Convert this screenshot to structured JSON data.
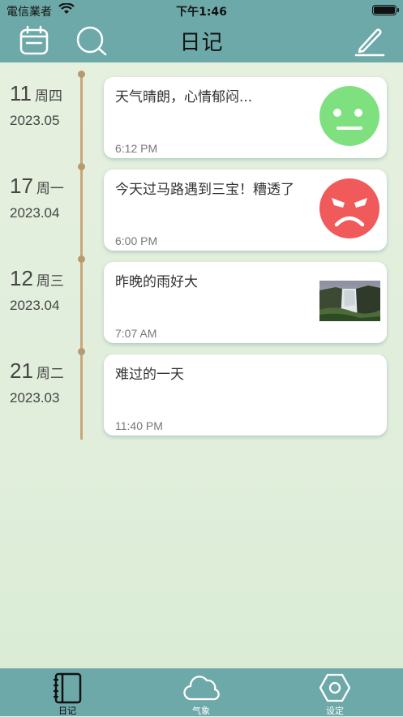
{
  "status_bar": {
    "carrier": "電信業者",
    "time": "下午1:46"
  },
  "nav": {
    "title": "日记",
    "left_icons": [
      "calendar-icon",
      "search-icon"
    ],
    "right_icon": "edit-icon"
  },
  "entries": [
    {
      "day": "11",
      "weekday": "周四",
      "year_month": "2023.05",
      "title": "天气晴朗，心情郁闷...",
      "time": "6:12 PM",
      "media": "neutral-face-icon",
      "media_color": "#7fe07f"
    },
    {
      "day": "17",
      "weekday": "周一",
      "year_month": "2023.04",
      "title": "今天过马路遇到三宝！糟透了",
      "time": "6:00 PM",
      "media": "angry-face-icon",
      "media_color": "#f05a5a"
    },
    {
      "day": "12",
      "weekday": "周三",
      "year_month": "2023.04",
      "title": "昨晚的雨好大",
      "time": "7:07 AM",
      "media": "waterfall-photo"
    },
    {
      "day": "21",
      "weekday": "周二",
      "year_month": "2023.03",
      "title": "难过的一天",
      "time": "11:40 PM",
      "media": ""
    }
  ],
  "tabs": [
    {
      "label": "日记",
      "icon": "diary-icon",
      "active": true
    },
    {
      "label": "气象",
      "icon": "cloud-icon",
      "active": false
    },
    {
      "label": "设定",
      "icon": "settings-icon",
      "active": false
    }
  ],
  "colors": {
    "header": "#6ea9a9",
    "timeline": "#c9a77a",
    "neutral_face": "#7fe07f",
    "angry_face": "#f05a5a"
  }
}
